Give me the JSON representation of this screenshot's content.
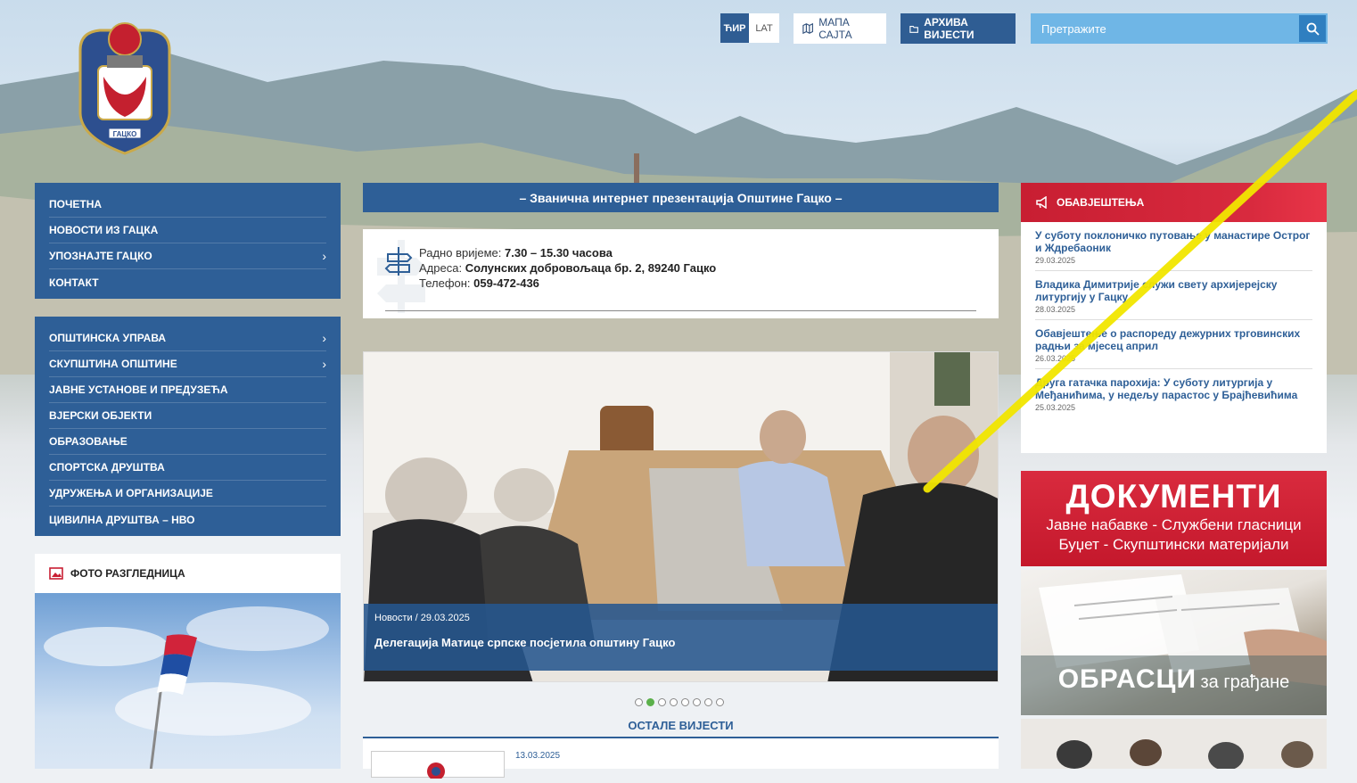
{
  "header": {
    "lang_cyr": "ЋИР",
    "lang_lat": "LAT",
    "sitemap_label": "МАПА САЈТА",
    "archive_label": "АРХИВА ВИЈЕСТИ",
    "search_placeholder": "Претражите",
    "logo_text": "ГАЦКО"
  },
  "menu_main": [
    {
      "label": "ПОЧЕТНА",
      "has_sub": false
    },
    {
      "label": "НОВОСТИ ИЗ ГАЦКА",
      "has_sub": false
    },
    {
      "label": "УПОЗНАЈТЕ ГАЦКО",
      "has_sub": true
    },
    {
      "label": "КОНТАКТ",
      "has_sub": false
    }
  ],
  "menu_secondary": [
    {
      "label": "ОПШТИНСКА УПРАВА",
      "has_sub": true
    },
    {
      "label": "СКУПШТИНА ОПШТИНЕ",
      "has_sub": true
    },
    {
      "label": "ЈАВНЕ УСТАНОВЕ И ПРЕДУЗЕЋА",
      "has_sub": false
    },
    {
      "label": "ВЈЕРСКИ ОБЈЕКТИ",
      "has_sub": false
    },
    {
      "label": "ОБРАЗОВАЊЕ",
      "has_sub": false
    },
    {
      "label": "СПОРТСКА ДРУШТВА",
      "has_sub": false
    },
    {
      "label": "УДРУЖЕЊА И ОРГАНИЗАЦИЈЕ",
      "has_sub": false
    },
    {
      "label": "ЦИВИЛНА ДРУШТВА – НВО",
      "has_sub": false
    }
  ],
  "photo": {
    "title": "ФОТО РАЗГЛЕДНИЦА"
  },
  "banner": "– Званична интернет презентација Општине Гацко –",
  "info": {
    "hours_label": "Радно вријеме:",
    "hours_value": "7.30 – 15.30 часова",
    "address_label": "Адреса:",
    "address_value": "Солунских добровољаца бр. 2, 89240 Гацко",
    "phone_label": "Телефон:",
    "phone_value": "059-472-436"
  },
  "slider": {
    "category": "Новости",
    "date": "29.03.2025",
    "title": "Делегација Матице српске посјетила општину Гацко",
    "dots": 8,
    "active_dot": 2
  },
  "other_news": {
    "heading": "ОСТАЛЕ ВИЈЕСТИ",
    "first_date": "13.03.2025"
  },
  "notices": {
    "title": "ОБАВЈЕШТЕЊА",
    "items": [
      {
        "title": "У суботу поклоничко путовање у манастире Острог и Ждребаоник",
        "date": "29.03.2025"
      },
      {
        "title": "Владика Димитрије служи свету архијерејску литургију у Гацку",
        "date": "28.03.2025"
      },
      {
        "title": "Обавјештење о распореду дежурних трговинских радњи за мјесец април",
        "date": "26.03.2025"
      },
      {
        "title": "Друга гатачка парохија: У суботу литургија у Међанићима, у недељу парастос у Брајћевићима",
        "date": "25.03.2025"
      }
    ]
  },
  "documents": {
    "big": "ДОКУМЕНТИ",
    "line1": "Јавне набавке - Службени гласници",
    "line2": "Буџет - Скупштински материјали"
  },
  "forms": {
    "big": "ОБРАСЦИ",
    "small": "за грађане"
  },
  "colors": {
    "primary": "#2e5f97",
    "accent_red": "#c81e32",
    "search": "#6fb6e6",
    "dot_active": "#5bb04a"
  }
}
